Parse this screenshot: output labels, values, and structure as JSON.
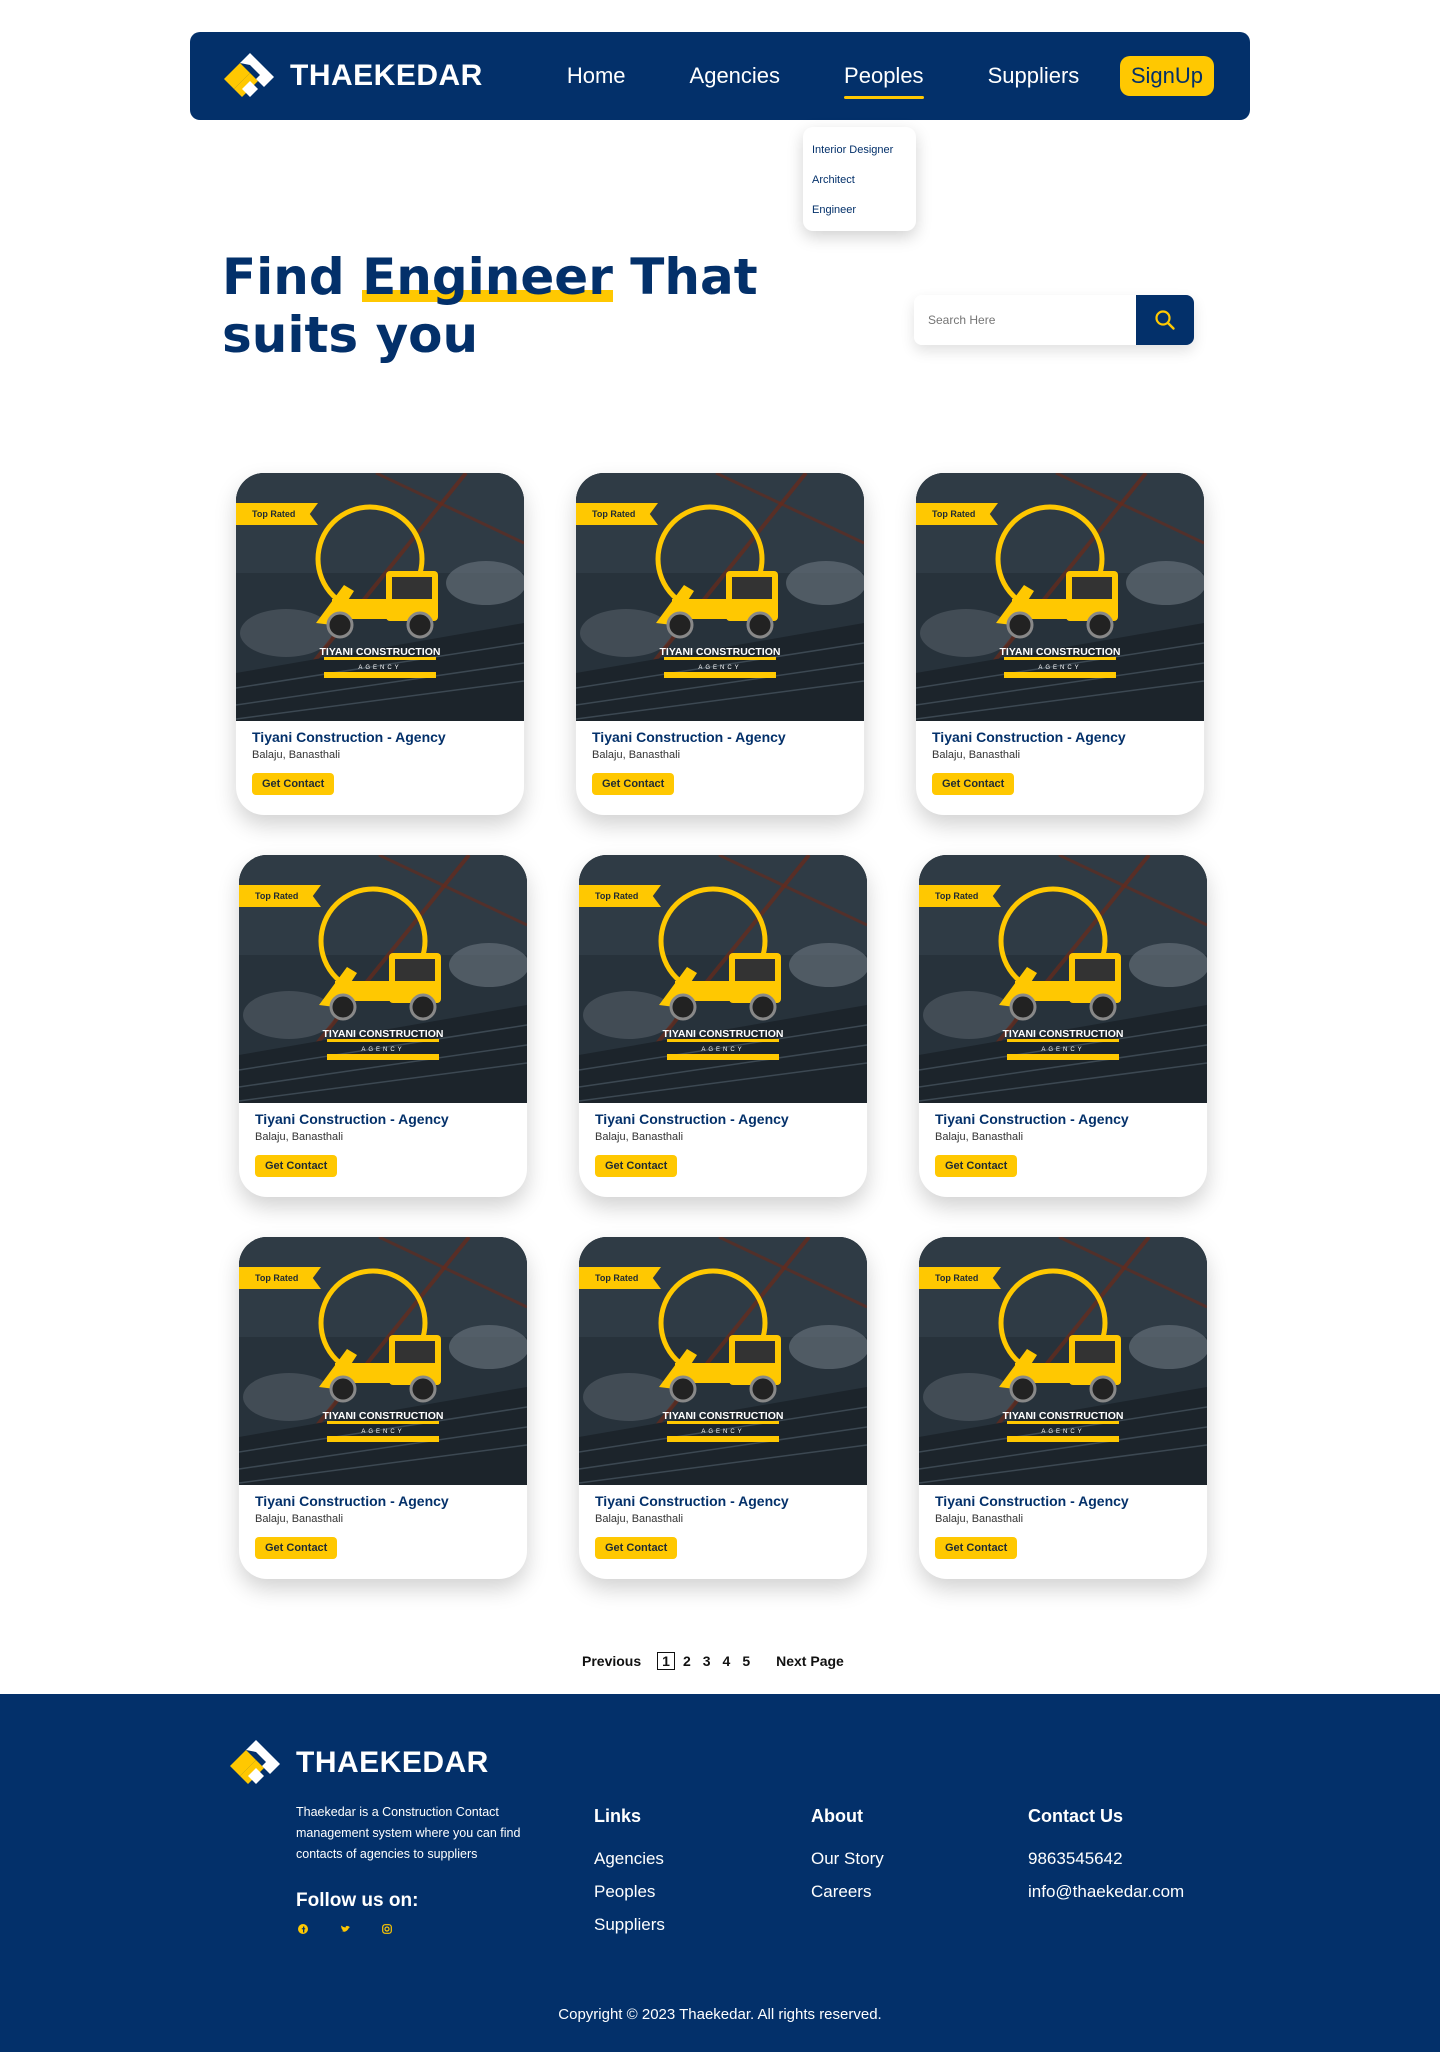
{
  "nav": {
    "brand": "THAEKEDAR",
    "links": [
      "Home",
      "Agencies",
      "Peoples",
      "Suppliers"
    ],
    "active": "Peoples",
    "signup_label": "SignUp",
    "dropdown": [
      "Interior Designer",
      "Architect",
      "Engineer"
    ]
  },
  "hero": {
    "title_part1": "Find ",
    "title_highlight": "Engineer",
    "title_part2": " That suits you"
  },
  "search": {
    "placeholder": "Search Here",
    "icon": "search-icon"
  },
  "card_template": {
    "badge": "Top Rated",
    "logo_line1": "TIYANI CONSTRUCTION",
    "logo_line2": "AGENCY",
    "name": "Tiyani Construction - Agency",
    "location": "Balaju, Banasthali",
    "button_label": "Get Contact"
  },
  "cards": [
    {
      "badge": "Top Rated",
      "name": "Tiyani Construction - Agency",
      "location": "Balaju, Banasthali",
      "button": "Get Contact"
    },
    {
      "badge": "Top Rated",
      "name": "Tiyani Construction - Agency",
      "location": "Balaju, Banasthali",
      "button": "Get Contact"
    },
    {
      "badge": "Top Rated",
      "name": "Tiyani Construction - Agency",
      "location": "Balaju, Banasthali",
      "button": "Get Contact"
    },
    {
      "badge": "Top Rated",
      "name": "Tiyani Construction - Agency",
      "location": "Balaju, Banasthali",
      "button": "Get Contact"
    },
    {
      "badge": "Top Rated",
      "name": "Tiyani Construction - Agency",
      "location": "Balaju, Banasthali",
      "button": "Get Contact"
    },
    {
      "badge": "Top Rated",
      "name": "Tiyani Construction - Agency",
      "location": "Balaju, Banasthali",
      "button": "Get Contact"
    },
    {
      "badge": "Top Rated",
      "name": "Tiyani Construction - Agency",
      "location": "Balaju, Banasthali",
      "button": "Get Contact"
    },
    {
      "badge": "Top Rated",
      "name": "Tiyani Construction - Agency",
      "location": "Balaju, Banasthali",
      "button": "Get Contact"
    },
    {
      "badge": "Top Rated",
      "name": "Tiyani Construction - Agency",
      "location": "Balaju, Banasthali",
      "button": "Get Contact"
    }
  ],
  "pagination": {
    "previous": "Previous",
    "pages": [
      "1",
      "2",
      "3",
      "4",
      "5"
    ],
    "current": "1",
    "next": "Next Page"
  },
  "footer": {
    "brand": "THAEKEDAR",
    "description": "Thaekedar is a Construction Contact management system where you can find contacts of agencies to suppliers",
    "follow": "Follow us on:",
    "social_icons": [
      "facebook-icon",
      "twitter-icon",
      "instagram-icon"
    ],
    "links_title": "Links",
    "links": [
      "Agencies",
      "Peoples",
      "Suppliers"
    ],
    "about_title": "About",
    "about": [
      "Our Story",
      "Careers"
    ],
    "contact_title": "Contact Us",
    "contact": [
      "9863545642",
      "info@thaekedar.com"
    ],
    "copyright": "Copyright © 2023 Thaekedar. All rights reserved."
  },
  "colors": {
    "primary": "#03306a",
    "accent": "#ffc801",
    "background": "#ffffff"
  }
}
